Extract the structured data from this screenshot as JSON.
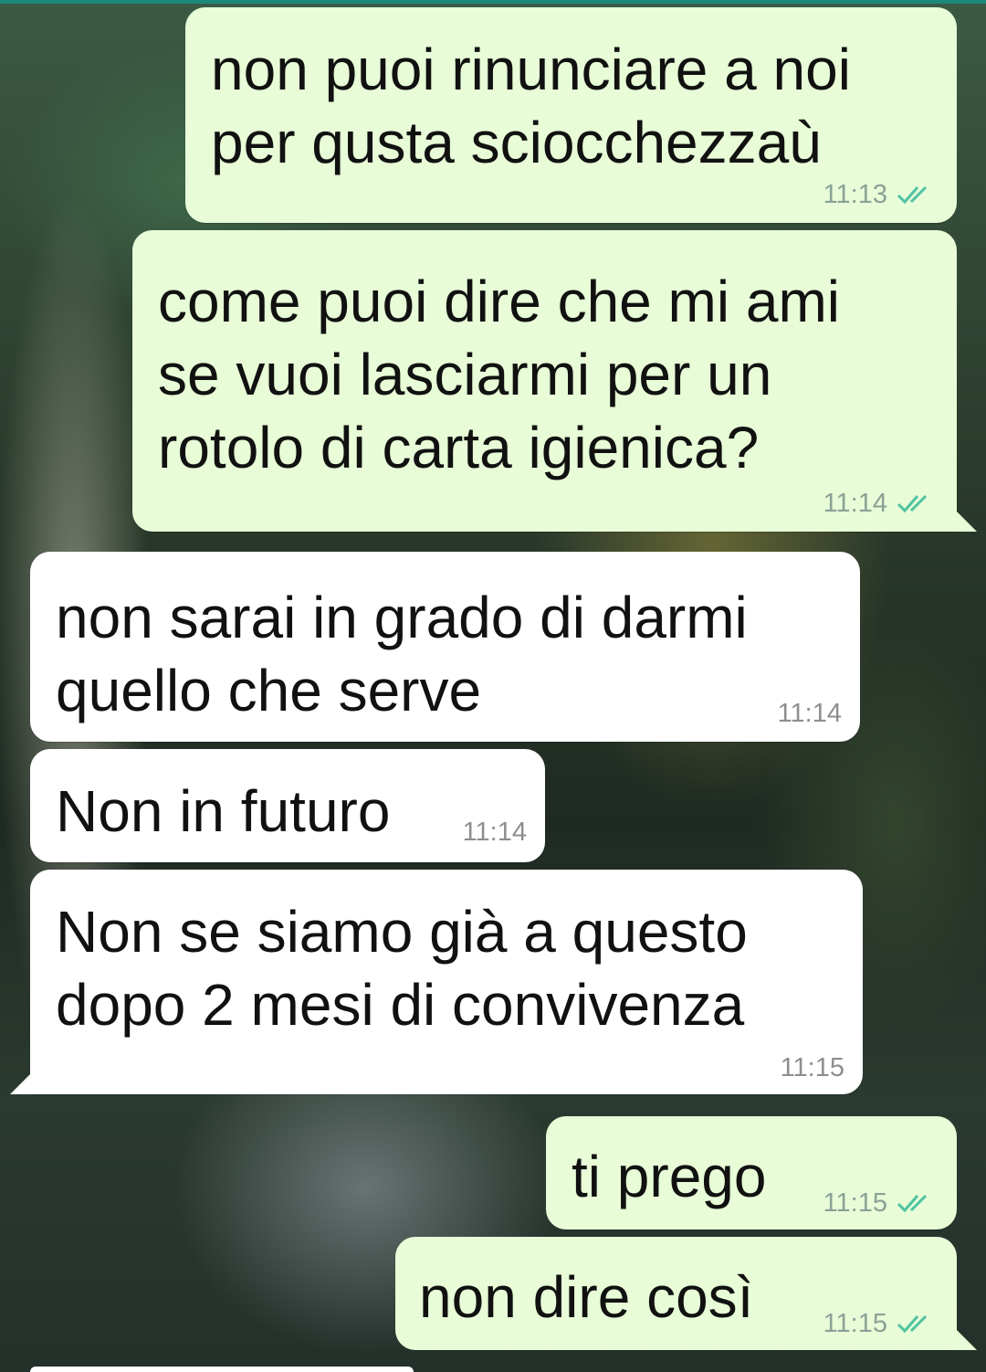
{
  "messages": [
    {
      "direction": "outgoing",
      "text": "non puoi rinunciare a noi\nper qusta sciocchezzaù",
      "time": "11:13",
      "status": "read"
    },
    {
      "direction": "outgoing",
      "text": "come puoi dire che mi ami\nse vuoi lasciarmi per un\nrotolo di carta igienica?",
      "time": "11:14",
      "status": "read"
    },
    {
      "direction": "incoming",
      "text": "non sarai in grado di darmi\nquello che serve",
      "time": "11:14"
    },
    {
      "direction": "incoming",
      "text": "Non in futuro",
      "time": "11:14"
    },
    {
      "direction": "incoming",
      "text": "Non se siamo già a questo\ndopo 2 mesi di convivenza",
      "time": "11:15"
    },
    {
      "direction": "outgoing",
      "text": "ti prego",
      "time": "11:15",
      "status": "read"
    },
    {
      "direction": "outgoing",
      "text": "non dire così",
      "time": "11:15",
      "status": "read"
    }
  ],
  "colors": {
    "outgoing_bubble": "#e7fcd7",
    "incoming_bubble": "#ffffff",
    "read_tick": "#4fc3a1",
    "accent": "#1c8a7a"
  },
  "icons": {
    "read_status": "double-check-icon"
  }
}
